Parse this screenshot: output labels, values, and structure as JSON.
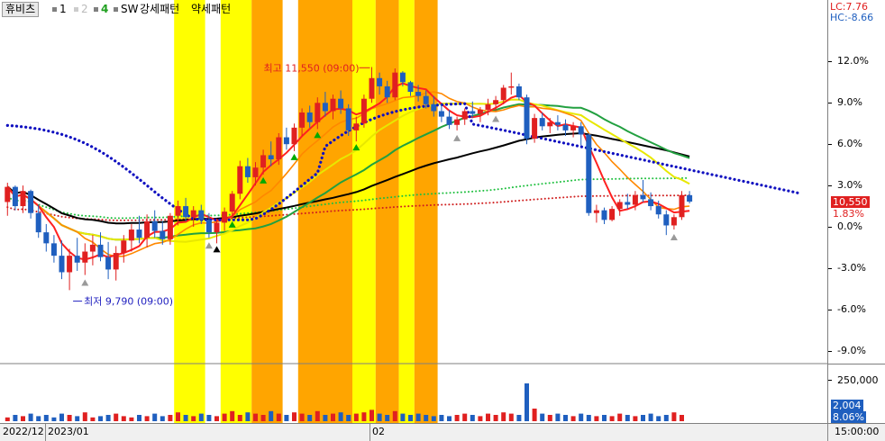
{
  "toolbar": {
    "stock_name": "휴비츠",
    "items": [
      "1",
      "2",
      "4"
    ],
    "label_sw": "SW",
    "label_strong": "강세패턴",
    "label_weak": "약세패턴"
  },
  "right_panel": {
    "lc": "LC:7.76",
    "hc": "HC:-8.66",
    "price_badge": "10,550",
    "change_badge": "1.83%",
    "volume_label": "250,000",
    "volume_badge": "2,004",
    "volume_pct_badge": "8.06%"
  },
  "bottom": {
    "dates": [
      "2022/12",
      "2023/01",
      "02"
    ],
    "time": "15:00:00"
  },
  "annotations": {
    "high": "최고 11,550 (09:00)",
    "low": "최저 9,790 (09:00)"
  },
  "colors": {
    "up": "#e02020",
    "down": "#1f5fbf",
    "highlight_yellow": "#ffff00",
    "highlight_orange": "#ffa500",
    "ma_red": "#ff2020",
    "ma_orange": "#ff8800",
    "ma_yellow": "#e8e800",
    "ma_green": "#22a040",
    "ma_black": "#000000",
    "dotted_blue": "#1010c0"
  },
  "chart_data": {
    "type": "candlestick",
    "y_axis": {
      "unit": "%",
      "ticks": [
        "12.0%",
        "9.0%",
        "6.0%",
        "3.0%",
        "0.0%",
        "-3.0%",
        "-6.0%",
        "-9.0%"
      ],
      "ylim": [
        -10,
        14.5
      ]
    },
    "volume_axis": {
      "ticks": [
        "250,000"
      ]
    },
    "x_labels": [
      "2022/12",
      "2023/01",
      "02"
    ],
    "candles": [
      [
        1.8,
        3.2,
        0.8,
        2.9
      ],
      [
        2.9,
        3.0,
        1.2,
        1.5
      ],
      [
        1.5,
        3.0,
        1.0,
        2.6
      ],
      [
        2.6,
        2.7,
        0.6,
        1.0
      ],
      [
        1.0,
        1.6,
        -0.8,
        -0.4
      ],
      [
        -0.4,
        0.2,
        -1.8,
        -1.2
      ],
      [
        -1.2,
        -0.6,
        -2.6,
        -2.1
      ],
      [
        -2.1,
        -1.0,
        -3.8,
        -3.3
      ],
      [
        -3.3,
        -1.6,
        -4.6,
        -2.1
      ],
      [
        -2.1,
        -0.8,
        -3.2,
        -2.6
      ],
      [
        -2.6,
        -1.2,
        -3.5,
        -1.8
      ],
      [
        -1.8,
        -0.6,
        -2.8,
        -1.3
      ],
      [
        -1.3,
        -0.4,
        -2.5,
        -2.2
      ],
      [
        -2.2,
        -1.1,
        -3.8,
        -3.1
      ],
      [
        -3.1,
        -1.4,
        -3.9,
        -1.9
      ],
      [
        -1.9,
        -0.6,
        -2.6,
        -1.0
      ],
      [
        -1.0,
        0.2,
        -1.8,
        -0.2
      ],
      [
        -0.2,
        0.8,
        -1.2,
        -0.8
      ],
      [
        -0.8,
        0.9,
        -1.5,
        0.4
      ],
      [
        0.4,
        1.2,
        -0.8,
        -0.3
      ],
      [
        -0.3,
        0.4,
        -1.3,
        -0.9
      ],
      [
        -0.9,
        1.0,
        -1.3,
        0.8
      ],
      [
        0.8,
        1.9,
        0.1,
        1.5
      ],
      [
        1.5,
        2.1,
        0.4,
        0.7
      ],
      [
        0.7,
        1.5,
        0.0,
        1.2
      ],
      [
        1.2,
        1.6,
        0.2,
        0.5
      ],
      [
        0.5,
        1.0,
        -0.8,
        -0.4
      ],
      [
        -0.4,
        0.6,
        -1.2,
        0.3
      ],
      [
        0.3,
        1.4,
        -0.3,
        1.1
      ],
      [
        1.1,
        2.6,
        0.6,
        2.4
      ],
      [
        2.4,
        4.8,
        2.0,
        4.4
      ],
      [
        4.4,
        5.0,
        3.2,
        3.6
      ],
      [
        3.6,
        4.7,
        3.0,
        4.3
      ],
      [
        4.3,
        5.6,
        3.8,
        5.2
      ],
      [
        5.2,
        6.2,
        4.4,
        4.9
      ],
      [
        4.9,
        6.8,
        4.5,
        6.5
      ],
      [
        6.5,
        7.2,
        5.6,
        6.0
      ],
      [
        6.0,
        7.5,
        5.5,
        7.2
      ],
      [
        7.2,
        8.6,
        6.6,
        8.3
      ],
      [
        8.3,
        8.8,
        7.2,
        7.6
      ],
      [
        7.6,
        9.4,
        7.1,
        9.0
      ],
      [
        9.0,
        9.8,
        8.0,
        8.4
      ],
      [
        8.4,
        9.6,
        7.8,
        9.3
      ],
      [
        9.3,
        9.9,
        8.2,
        8.6
      ],
      [
        8.6,
        8.9,
        6.6,
        7.0
      ],
      [
        7.0,
        8.0,
        6.2,
        7.5
      ],
      [
        7.5,
        9.6,
        7.2,
        9.3
      ],
      [
        9.3,
        11.6,
        9.0,
        10.8
      ],
      [
        10.8,
        11.2,
        9.6,
        10.2
      ],
      [
        10.2,
        10.6,
        9.0,
        9.4
      ],
      [
        9.4,
        11.5,
        9.2,
        11.2
      ],
      [
        11.2,
        11.3,
        10.2,
        10.5
      ],
      [
        10.5,
        10.6,
        9.5,
        9.8
      ],
      [
        9.8,
        10.3,
        9.1,
        9.5
      ],
      [
        9.5,
        9.9,
        8.6,
        8.9
      ],
      [
        8.9,
        9.5,
        8.0,
        8.4
      ],
      [
        8.4,
        8.9,
        7.6,
        8.0
      ],
      [
        8.0,
        8.5,
        7.1,
        7.4
      ],
      [
        7.4,
        8.0,
        7.0,
        7.8
      ],
      [
        7.8,
        8.6,
        7.4,
        8.4
      ],
      [
        8.4,
        9.1,
        7.9,
        8.2
      ],
      [
        8.2,
        8.7,
        7.6,
        8.5
      ],
      [
        8.5,
        9.3,
        8.1,
        8.9
      ],
      [
        8.9,
        9.5,
        8.4,
        9.2
      ],
      [
        9.2,
        10.3,
        8.9,
        10.1
      ],
      [
        10.1,
        11.2,
        9.6,
        10.2
      ],
      [
        10.2,
        10.4,
        9.2,
        9.4
      ],
      [
        9.4,
        9.6,
        6.0,
        6.4
      ],
      [
        6.4,
        8.2,
        6.1,
        7.9
      ],
      [
        7.9,
        8.3,
        7.0,
        7.3
      ],
      [
        7.3,
        7.9,
        6.8,
        7.6
      ],
      [
        7.6,
        8.1,
        7.0,
        7.4
      ],
      [
        7.4,
        7.8,
        6.6,
        7.0
      ],
      [
        7.0,
        7.6,
        6.5,
        7.3
      ],
      [
        7.3,
        7.6,
        5.9,
        6.7
      ],
      [
        6.7,
        6.8,
        0.8,
        1.0
      ],
      [
        1.0,
        1.6,
        0.3,
        1.2
      ],
      [
        1.2,
        1.4,
        0.2,
        0.5
      ],
      [
        0.5,
        1.5,
        0.4,
        1.3
      ],
      [
        1.3,
        2.0,
        0.8,
        1.8
      ],
      [
        1.8,
        2.4,
        1.3,
        1.6
      ],
      [
        1.6,
        2.6,
        1.2,
        2.3
      ],
      [
        2.3,
        3.4,
        1.8,
        2.0
      ],
      [
        2.0,
        2.5,
        1.2,
        1.5
      ],
      [
        1.5,
        1.9,
        0.6,
        0.9
      ],
      [
        0.9,
        1.2,
        -0.6,
        0.1
      ],
      [
        0.1,
        0.9,
        -0.2,
        0.7
      ],
      [
        0.7,
        2.6,
        0.5,
        2.3
      ],
      [
        2.3,
        2.6,
        1.7,
        1.83
      ]
    ],
    "volumes": [
      3,
      5,
      4,
      6,
      4,
      5,
      3,
      6,
      5,
      4,
      7,
      3,
      4,
      5,
      6,
      4,
      3,
      5,
      4,
      6,
      4,
      5,
      7,
      5,
      4,
      6,
      5,
      4,
      6,
      8,
      5,
      7,
      6,
      5,
      8,
      6,
      5,
      7,
      6,
      5,
      8,
      5,
      6,
      7,
      5,
      6,
      7,
      9,
      6,
      5,
      8,
      6,
      5,
      6,
      5,
      4,
      5,
      4,
      5,
      6,
      5,
      4,
      6,
      5,
      7,
      6,
      5,
      30,
      10,
      6,
      5,
      6,
      5,
      4,
      6,
      5,
      4,
      5,
      4,
      6,
      5,
      4,
      5,
      6,
      4,
      5,
      7,
      5
    ],
    "highlight_bands": [
      {
        "from": 22,
        "to": 26,
        "color": "yellow"
      },
      {
        "from": 28,
        "to": 32,
        "color": "yellow"
      },
      {
        "from": 32,
        "to": 36,
        "color": "orange"
      },
      {
        "from": 38,
        "to": 45,
        "color": "orange"
      },
      {
        "from": 45,
        "to": 48,
        "color": "yellow"
      },
      {
        "from": 48,
        "to": 51,
        "color": "orange"
      },
      {
        "from": 51,
        "to": 53,
        "color": "yellow"
      },
      {
        "from": 53,
        "to": 56,
        "color": "orange"
      }
    ]
  }
}
